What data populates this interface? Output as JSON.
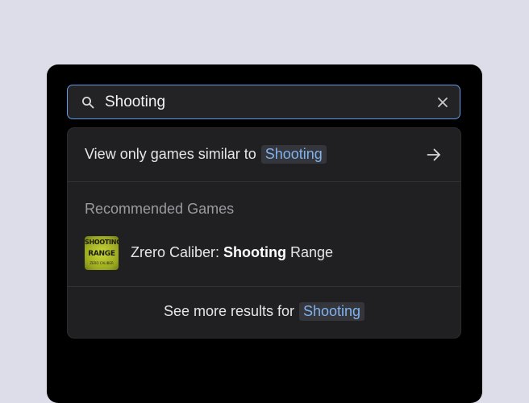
{
  "search": {
    "value": "Shooting",
    "icon": "search-icon",
    "clear_icon": "close-icon"
  },
  "dropdown": {
    "similar": {
      "prefix": "View only games similar to",
      "term": "Shooting",
      "icon": "arrow-right-icon"
    },
    "recommended": {
      "heading": "Recommended Games",
      "games": [
        {
          "title_prefix": "Zrero Caliber: ",
          "title_match": "Shooting",
          "title_suffix": " Range",
          "thumb_line1": "SHOOTING",
          "thumb_line2": "RANGE",
          "thumb_sub": "ZERO CALIBER"
        }
      ]
    },
    "see_more": {
      "prefix": "See more results for",
      "term": "Shooting"
    }
  },
  "colors": {
    "background": "#dcdde8",
    "device": "#000000",
    "panel": "#202022",
    "accent_border": "#5e9ce6",
    "chip_text": "#7fb2ef"
  }
}
